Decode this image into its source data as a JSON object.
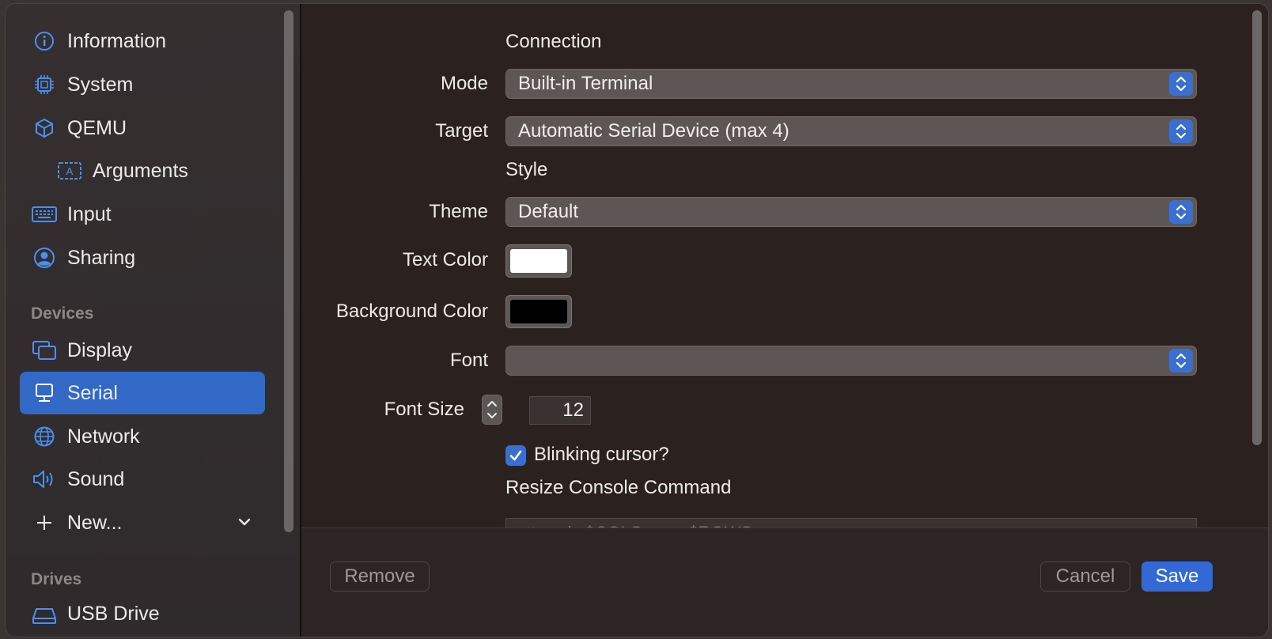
{
  "sidebar": {
    "items": [
      {
        "label": "Information",
        "icon": "info-circle-icon"
      },
      {
        "label": "System",
        "icon": "cpu-chip-icon"
      },
      {
        "label": "QEMU",
        "icon": "cube-icon"
      },
      {
        "label": "Arguments",
        "icon": "text-box-icon"
      },
      {
        "label": "Input",
        "icon": "keyboard-icon"
      },
      {
        "label": "Sharing",
        "icon": "person-circle-icon"
      }
    ],
    "devices_heading": "Devices",
    "devices": [
      {
        "label": "Display",
        "icon": "display-windows-icon"
      },
      {
        "label": "Serial",
        "icon": "terminal-monitor-icon"
      },
      {
        "label": "Network",
        "icon": "globe-icon"
      },
      {
        "label": "Sound",
        "icon": "speaker-icon"
      }
    ],
    "new_label": "New...",
    "drives_heading": "Drives",
    "drives": [
      {
        "label": "USB Drive",
        "icon": "drive-icon"
      }
    ],
    "accent": "#3369c6"
  },
  "form": {
    "connection_heading": "Connection",
    "mode_label": "Mode",
    "mode_value": "Built-in Terminal",
    "target_label": "Target",
    "target_value": "Automatic Serial Device (max 4)",
    "style_heading": "Style",
    "theme_label": "Theme",
    "theme_value": "Default",
    "text_color_label": "Text Color",
    "text_color_value": "#ffffff",
    "background_color_label": "Background Color",
    "background_color_value": "#000000",
    "font_label": "Font",
    "font_value": "",
    "font_size_label": "Font Size",
    "font_size_value": "12",
    "blinking_cursor_label": "Blinking cursor?",
    "blinking_cursor_checked": true,
    "resize_heading": "Resize Console Command",
    "resize_placeholder": "stty cols $COLS rows $ROWS"
  },
  "footer": {
    "remove_label": "Remove",
    "cancel_label": "Cancel",
    "save_label": "Save"
  }
}
